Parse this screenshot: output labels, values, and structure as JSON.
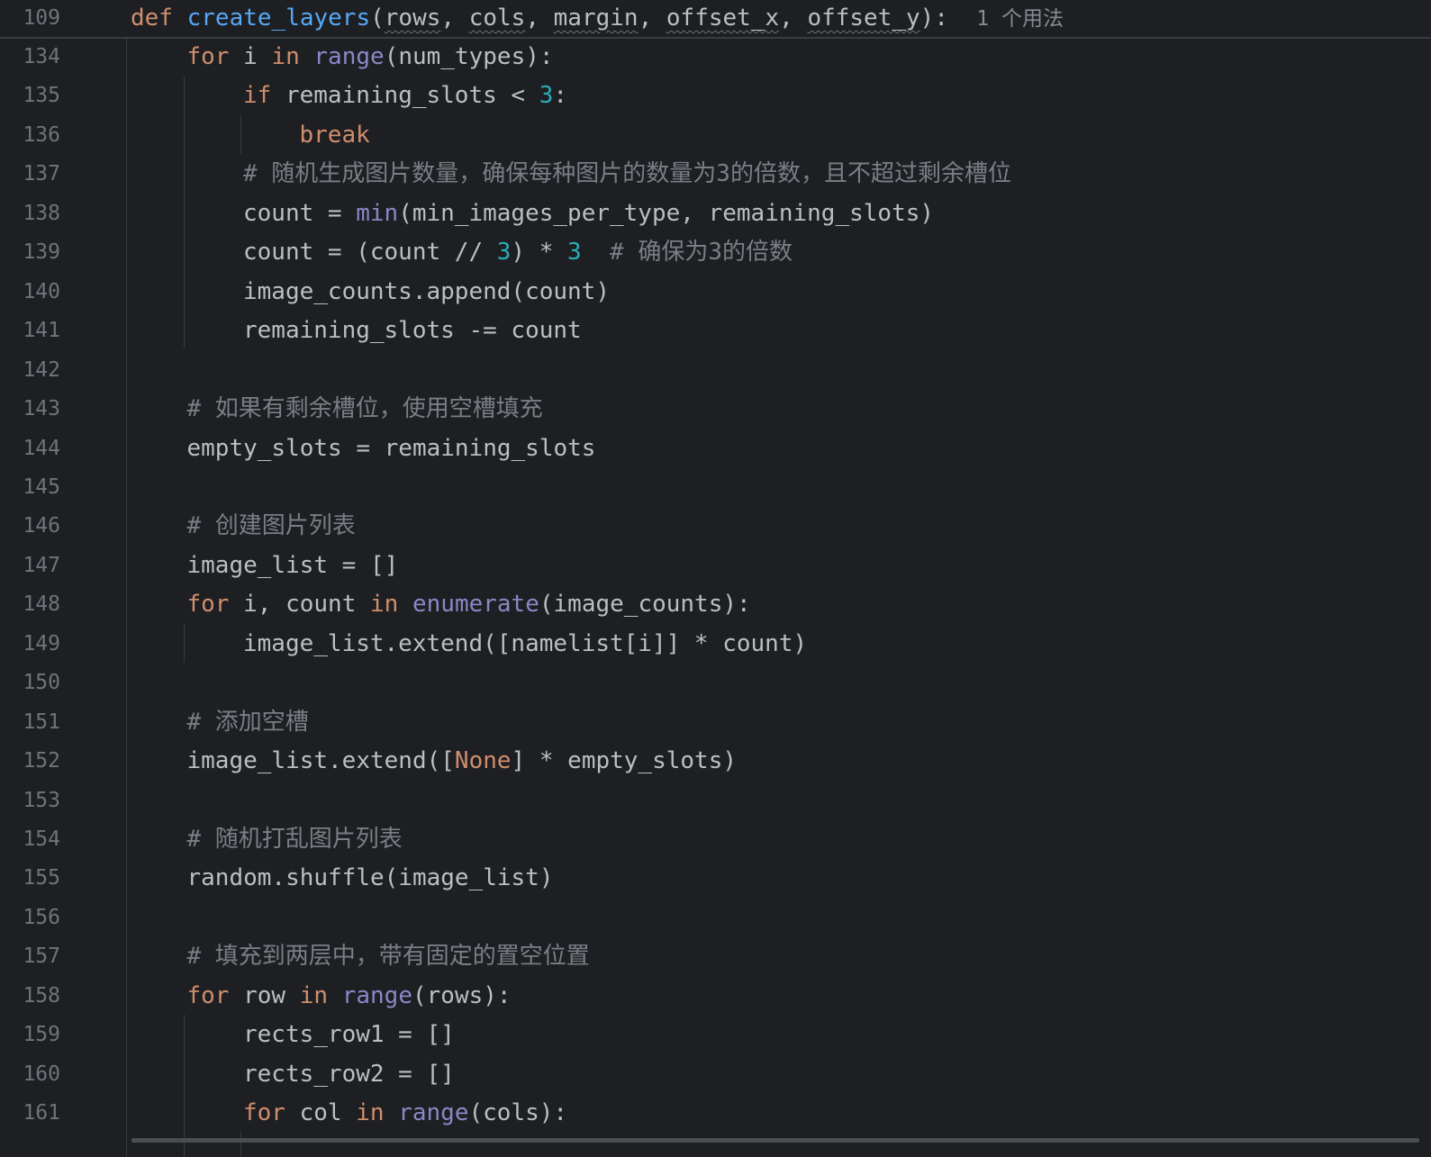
{
  "sticky_header": {
    "line_number": "109",
    "def_kw": "def",
    "func_name": "create_layers",
    "open_paren": "(",
    "params": [
      "rows",
      "cols",
      "margin",
      "offset_x",
      "offset_y"
    ],
    "sep": ", ",
    "close": "):",
    "usage_hint": "1 个用法"
  },
  "lines": [
    {
      "num": "134",
      "indent": 1,
      "tokens": [
        {
          "t": "k",
          "v": "for"
        },
        {
          "t": "p",
          "v": " i "
        },
        {
          "t": "k",
          "v": "in"
        },
        {
          "t": "p",
          "v": " "
        },
        {
          "t": "bi",
          "v": "range"
        },
        {
          "t": "p",
          "v": "(num_types):"
        }
      ]
    },
    {
      "num": "135",
      "indent": 2,
      "tokens": [
        {
          "t": "k",
          "v": "if"
        },
        {
          "t": "p",
          "v": " remaining_slots < "
        },
        {
          "t": "n",
          "v": "3"
        },
        {
          "t": "p",
          "v": ":"
        }
      ]
    },
    {
      "num": "136",
      "indent": 3,
      "tokens": [
        {
          "t": "k",
          "v": "break"
        }
      ]
    },
    {
      "num": "137",
      "indent": 2,
      "tokens": [
        {
          "t": "cm",
          "v": "# 随机生成图片数量，确保每种图片的数量为3的倍数，且不超过剩余槽位"
        }
      ]
    },
    {
      "num": "138",
      "indent": 2,
      "tokens": [
        {
          "t": "p",
          "v": "count = "
        },
        {
          "t": "bi",
          "v": "min"
        },
        {
          "t": "p",
          "v": "(min_images_per_type, remaining_slots)"
        }
      ]
    },
    {
      "num": "139",
      "indent": 2,
      "tokens": [
        {
          "t": "p",
          "v": "count = (count // "
        },
        {
          "t": "n",
          "v": "3"
        },
        {
          "t": "p",
          "v": ") * "
        },
        {
          "t": "n",
          "v": "3"
        },
        {
          "t": "p",
          "v": "  "
        },
        {
          "t": "cm",
          "v": "# 确保为3的倍数"
        }
      ]
    },
    {
      "num": "140",
      "indent": 2,
      "tokens": [
        {
          "t": "p",
          "v": "image_counts.append(count)"
        }
      ]
    },
    {
      "num": "141",
      "indent": 2,
      "tokens": [
        {
          "t": "p",
          "v": "remaining_slots -= count"
        }
      ]
    },
    {
      "num": "142",
      "indent": 0,
      "tokens": []
    },
    {
      "num": "143",
      "indent": 1,
      "tokens": [
        {
          "t": "cm",
          "v": "# 如果有剩余槽位，使用空槽填充"
        }
      ]
    },
    {
      "num": "144",
      "indent": 1,
      "tokens": [
        {
          "t": "p",
          "v": "empty_slots = remaining_slots"
        }
      ]
    },
    {
      "num": "145",
      "indent": 0,
      "tokens": []
    },
    {
      "num": "146",
      "indent": 1,
      "tokens": [
        {
          "t": "cm",
          "v": "# 创建图片列表"
        }
      ]
    },
    {
      "num": "147",
      "indent": 1,
      "tokens": [
        {
          "t": "p",
          "v": "image_list = []"
        }
      ]
    },
    {
      "num": "148",
      "indent": 1,
      "tokens": [
        {
          "t": "k",
          "v": "for"
        },
        {
          "t": "p",
          "v": " i, count "
        },
        {
          "t": "k",
          "v": "in"
        },
        {
          "t": "p",
          "v": " "
        },
        {
          "t": "bi",
          "v": "enumerate"
        },
        {
          "t": "p",
          "v": "(image_counts):"
        }
      ]
    },
    {
      "num": "149",
      "indent": 2,
      "tokens": [
        {
          "t": "p",
          "v": "image_list.extend([namelist[i]] * count)"
        }
      ]
    },
    {
      "num": "150",
      "indent": 0,
      "tokens": []
    },
    {
      "num": "151",
      "indent": 1,
      "tokens": [
        {
          "t": "cm",
          "v": "# 添加空槽"
        }
      ]
    },
    {
      "num": "152",
      "indent": 1,
      "tokens": [
        {
          "t": "p",
          "v": "image_list.extend(["
        },
        {
          "t": "k",
          "v": "None"
        },
        {
          "t": "p",
          "v": "] * empty_slots)"
        }
      ]
    },
    {
      "num": "153",
      "indent": 0,
      "tokens": []
    },
    {
      "num": "154",
      "indent": 1,
      "tokens": [
        {
          "t": "cm",
          "v": "# 随机打乱图片列表"
        }
      ]
    },
    {
      "num": "155",
      "indent": 1,
      "tokens": [
        {
          "t": "p",
          "v": "random.shuffle(image_list)"
        }
      ]
    },
    {
      "num": "156",
      "indent": 0,
      "tokens": []
    },
    {
      "num": "157",
      "indent": 1,
      "tokens": [
        {
          "t": "cm",
          "v": "# 填充到两层中，带有固定的置空位置"
        }
      ]
    },
    {
      "num": "158",
      "indent": 1,
      "tokens": [
        {
          "t": "k",
          "v": "for"
        },
        {
          "t": "p",
          "v": " row "
        },
        {
          "t": "k",
          "v": "in"
        },
        {
          "t": "p",
          "v": " "
        },
        {
          "t": "bi",
          "v": "range"
        },
        {
          "t": "p",
          "v": "(rows):"
        }
      ]
    },
    {
      "num": "159",
      "indent": 2,
      "tokens": [
        {
          "t": "p",
          "v": "rects_row1 = []"
        }
      ]
    },
    {
      "num": "160",
      "indent": 2,
      "tokens": [
        {
          "t": "p",
          "v": "rects_row2 = []"
        }
      ]
    },
    {
      "num": "161",
      "indent": 2,
      "tokens": [
        {
          "t": "k",
          "v": "for"
        },
        {
          "t": "p",
          "v": " col "
        },
        {
          "t": "k",
          "v": "in"
        },
        {
          "t": "p",
          "v": " "
        },
        {
          "t": "bi",
          "v": "range"
        },
        {
          "t": "p",
          "v": "(cols):"
        }
      ]
    }
  ],
  "colors": {
    "background": "#1e1f22",
    "keyword": "#cf8e6d",
    "builtin": "#8888c6",
    "function": "#56a8f5",
    "number": "#2aacb8",
    "comment": "#7a7e85",
    "text": "#bcbec4",
    "line_number": "#6f737a"
  }
}
